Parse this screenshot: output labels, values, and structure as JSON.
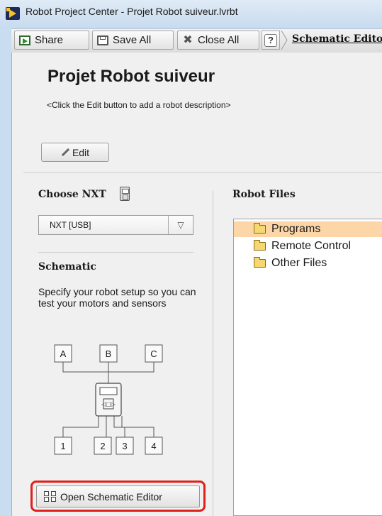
{
  "window": {
    "title": "Robot Project Center - Projet Robot suiveur.lvrbt"
  },
  "toolbar": {
    "share_label": "Share",
    "save_all_label": "Save All",
    "close_all_label": "Close All",
    "help_label": "?",
    "active_tab_label": "Schematic Edito"
  },
  "project": {
    "name": "Projet Robot suiveur",
    "description_hint": "<Click the Edit button to add a robot description>",
    "edit_label": "Edit"
  },
  "choose_nxt": {
    "heading": "Choose NXT",
    "selected": "NXT [USB]"
  },
  "schematic": {
    "heading": "Schematic",
    "description": "Specify your robot setup so you can test your motors and sensors",
    "motor_ports": [
      "A",
      "B",
      "C"
    ],
    "sensor_ports": [
      "1",
      "2",
      "3",
      "4"
    ],
    "open_editor_label": "Open Schematic Editor"
  },
  "robot_files": {
    "heading": "Robot Files",
    "items": [
      {
        "label": "Programs",
        "selected": true
      },
      {
        "label": "Remote Control",
        "selected": false
      },
      {
        "label": "Other Files",
        "selected": false
      }
    ]
  },
  "colors": {
    "highlight": "#e0201a",
    "selection": "#fcd6a6"
  },
  "icons": [
    "app-icon",
    "share-icon",
    "save-icon",
    "close-icon",
    "help-icon",
    "pencil-icon",
    "nxt-brick-icon",
    "chevron-down-icon",
    "schematic-icon",
    "folder-icon"
  ]
}
